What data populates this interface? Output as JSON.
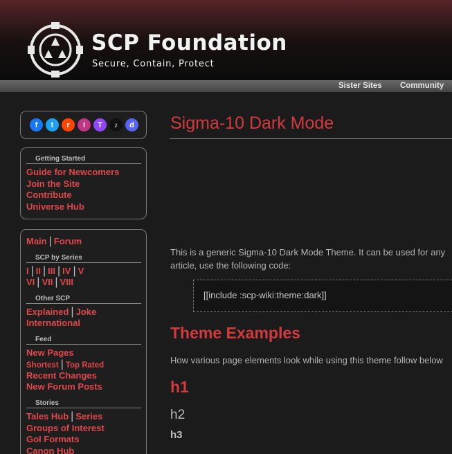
{
  "header": {
    "title": "SCP Foundation",
    "tagline": "Secure, Contain, Protect",
    "logo_icon": "scp-logo-icon"
  },
  "topbar": {
    "items": [
      "Sister Sites",
      "Community"
    ]
  },
  "social": {
    "icons": [
      {
        "name": "facebook-icon",
        "glyph": "f",
        "color": "#1877f2"
      },
      {
        "name": "twitter-icon",
        "glyph": "t",
        "color": "#1da1f2"
      },
      {
        "name": "reddit-icon",
        "glyph": "r",
        "color": "#ff4500"
      },
      {
        "name": "instagram-icon",
        "glyph": "i",
        "color": "#c13584"
      },
      {
        "name": "twitch-icon",
        "glyph": "T",
        "color": "#9146ff"
      },
      {
        "name": "tiktok-icon",
        "glyph": "♪",
        "color": "#111111"
      },
      {
        "name": "discord-icon",
        "glyph": "d",
        "color": "#5865f2"
      }
    ]
  },
  "getting_started": {
    "heading": "Getting Started",
    "links": [
      "Guide for Newcomers",
      "Join the Site",
      "Contribute",
      "Universe Hub"
    ]
  },
  "nav": {
    "main": "Main",
    "forum": "Forum",
    "scp_by_series": {
      "heading": "SCP by Series",
      "row1": [
        "I",
        "II",
        "III",
        "IV",
        "V"
      ],
      "row2": [
        "VI",
        "VII",
        "VIII"
      ]
    },
    "other_scp": {
      "heading": "Other SCP",
      "explained": "Explained",
      "joke": "Joke",
      "international": "International"
    },
    "feed": {
      "heading": "Feed",
      "new_pages": "New Pages",
      "shortest": "Shortest",
      "top_rated": "Top Rated",
      "recent_changes": "Recent Changes",
      "new_forum_posts": "New Forum Posts"
    },
    "stories": {
      "heading": "Stories",
      "tales_hub": "Tales Hub",
      "series": "Series",
      "groups_of_interest": "Groups of Interest",
      "goi_formats": "GoI Formats",
      "canon_hub": "Canon Hub"
    }
  },
  "main": {
    "title": "Sigma-10 Dark Mode",
    "intro_line1": "This is a generic Sigma-10 Dark Mode Theme. It can be used for any",
    "intro_line2": "article, use the following code:",
    "code": "[[include :scp-wiki:theme:dark]]",
    "theme_examples": "Theme Examples",
    "examples_intro": "How various page elements look while using this theme follow below",
    "h1": "h1",
    "h2": "h2",
    "h3": "h3"
  },
  "colors": {
    "accent": "#d23a3c",
    "link": "#e0474b",
    "background": "#1b1b1b"
  }
}
